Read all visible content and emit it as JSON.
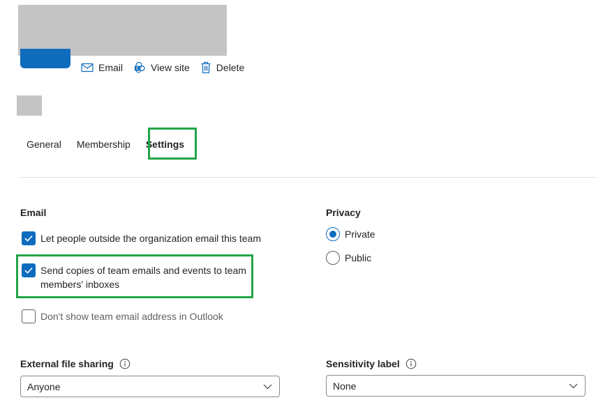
{
  "actions": {
    "email_label": "Email",
    "view_site_label": "View site",
    "delete_label": "Delete"
  },
  "tabs": [
    {
      "label": "General",
      "active": false
    },
    {
      "label": "Membership",
      "active": false
    },
    {
      "label": "Settings",
      "active": true
    }
  ],
  "email": {
    "title": "Email",
    "options": [
      {
        "label": "Let people outside the organization email this team",
        "checked": true
      },
      {
        "label": "Send copies of team emails and events to team members' inboxes",
        "checked": true
      },
      {
        "label": "Don't show team email address in Outlook",
        "checked": false
      }
    ]
  },
  "privacy": {
    "title": "Privacy",
    "options": [
      {
        "label": "Private",
        "selected": true
      },
      {
        "label": "Public",
        "selected": false
      }
    ]
  },
  "external_sharing": {
    "label": "External file sharing",
    "value": "Anyone"
  },
  "sensitivity": {
    "label": "Sensitivity label",
    "value": "None"
  },
  "colors": {
    "accent": "#0f6cbd",
    "highlight": "#22a447",
    "redaction": "#c4c4c4"
  }
}
